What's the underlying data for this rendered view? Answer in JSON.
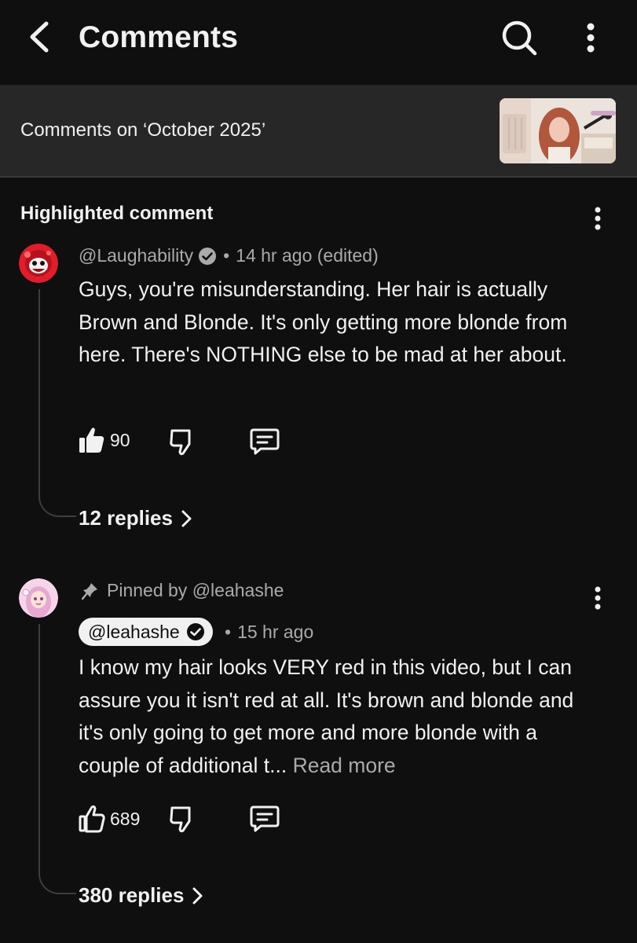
{
  "header": {
    "title": "Comments"
  },
  "context": {
    "label": "Comments on ‘October 2025’"
  },
  "highlighted": {
    "section_label": "Highlighted comment",
    "author": "@Laughability",
    "time": "14 hr ago (edited)",
    "text": "Guys, you're misunderstanding. Her hair is actually Brown and Blonde. It's only getting more blonde from here. There's NOTHING else to be mad at her about.",
    "likes": "90",
    "replies": "12 replies"
  },
  "pinned_comment": {
    "pinned_label": "Pinned by @leahashe",
    "author": "@leahashe",
    "time": "15 hr ago",
    "text": "I know my hair looks VERY red in this video, but I can assure you it isn't red at all. It's brown and blonde and it's only going to get more and more blonde with a couple of additional t...",
    "read_more": "Read more",
    "likes": "689",
    "replies": "380 replies"
  },
  "colors": {
    "background": "#0f0f0f",
    "context_bar": "#272727",
    "secondary_text": "#aaaaaa",
    "primary_text": "#f1f1f1"
  },
  "icons": [
    "back-arrow-icon",
    "search-icon",
    "more-vertical-icon",
    "verified-icon",
    "like-icon",
    "dislike-icon",
    "reply-icon",
    "pin-icon",
    "chevron-right-icon"
  ]
}
